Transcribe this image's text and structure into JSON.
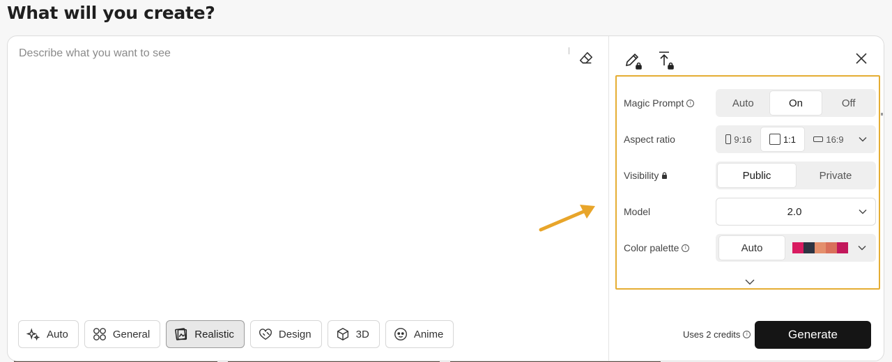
{
  "header": {
    "title": "What will you create?"
  },
  "prompt": {
    "placeholder": "Describe what you want to see"
  },
  "styles": [
    {
      "label": "Auto",
      "icon": "sparkle-icon",
      "active": false
    },
    {
      "label": "General",
      "icon": "grid-circles-icon",
      "active": false
    },
    {
      "label": "Realistic",
      "icon": "photo-frames-icon",
      "active": true
    },
    {
      "label": "Design",
      "icon": "design-icon",
      "active": false
    },
    {
      "label": "3D",
      "icon": "cube-icon",
      "active": false
    },
    {
      "label": "Anime",
      "icon": "face-icon",
      "active": false
    }
  ],
  "settings": {
    "magic_prompt": {
      "label": "Magic Prompt",
      "options": [
        "Auto",
        "On",
        "Off"
      ],
      "selected": "On"
    },
    "aspect_ratio": {
      "label": "Aspect ratio",
      "options": [
        "9:16",
        "1:1",
        "16:9"
      ],
      "selected": "1:1"
    },
    "visibility": {
      "label": "Visibility",
      "options": [
        "Public",
        "Private"
      ],
      "selected": "Public"
    },
    "model": {
      "label": "Model",
      "value": "2.0"
    },
    "color_palette": {
      "label": "Color palette",
      "value": "Auto",
      "swatches": [
        "#d81b60",
        "#2e3442",
        "#e48f6c",
        "#d9705a",
        "#c2185b"
      ]
    }
  },
  "footer": {
    "credits": "Uses 2 credits",
    "generate_label": "Generate"
  },
  "colors": {
    "highlight": "#e5ad33",
    "primary_button": "#151515"
  }
}
